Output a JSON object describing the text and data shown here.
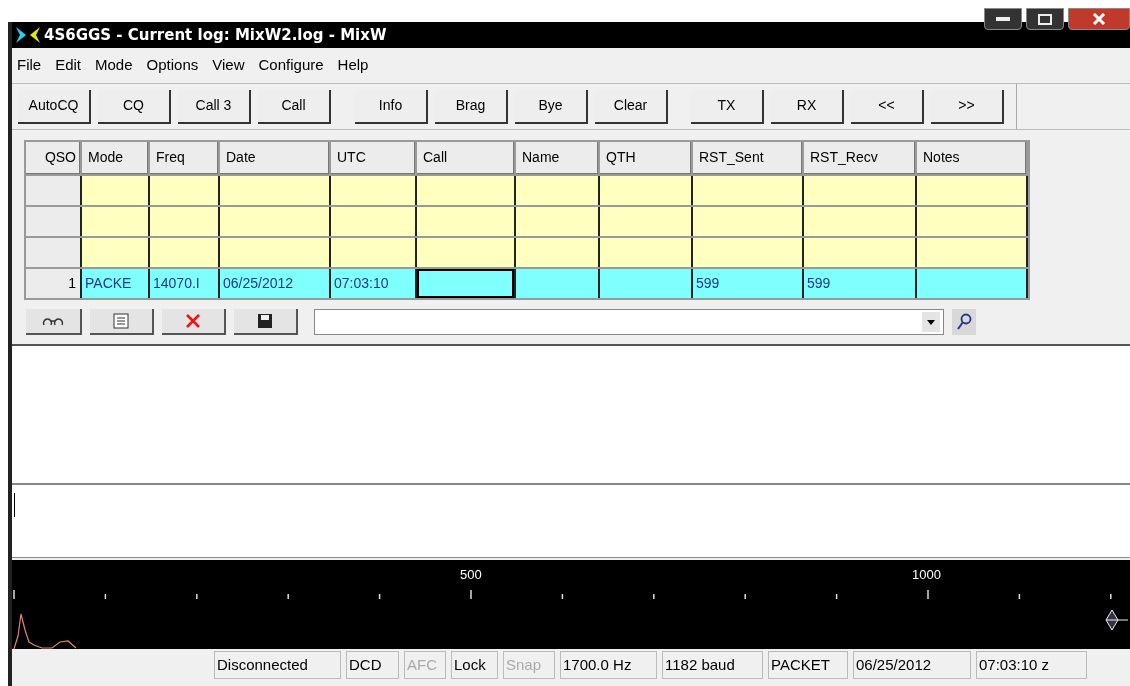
{
  "window": {
    "title": "4S6GGS - Current log: MixW2.log - MixW"
  },
  "menu": [
    "File",
    "Edit",
    "Mode",
    "Options",
    "View",
    "Configure",
    "Help"
  ],
  "macro_buttons": [
    "AutoCQ",
    "CQ",
    "Call 3",
    "Call",
    "Info",
    "Brag",
    "Bye",
    "Clear",
    "TX",
    "RX",
    "<<",
    ">>"
  ],
  "log_table": {
    "columns": [
      "QSO",
      "Mode",
      "Freq",
      "Date",
      "UTC",
      "Call",
      "Name",
      "QTH",
      "RST_Sent",
      "RST_Recv",
      "Notes"
    ],
    "rows": [
      {
        "current": false
      },
      {
        "current": false
      },
      {
        "current": false
      },
      {
        "current": true,
        "qso": "1",
        "cells": [
          {
            "text": "PACKE",
            "focused": false
          },
          {
            "text": "14070.I",
            "focused": false
          },
          {
            "text": "06/25/2012",
            "focused": false
          },
          {
            "text": "07:03:10",
            "focused": false
          },
          {
            "focused": true
          },
          {
            "focused": false
          },
          {
            "focused": false
          },
          {
            "text": "599",
            "focused": false
          },
          {
            "text": "599",
            "focused": false
          },
          {
            "focused": false
          }
        ]
      }
    ]
  },
  "scale": {
    "labels": [
      "500",
      "1000"
    ]
  },
  "status_bar": [
    {
      "text": "Disconnected",
      "disabled": false
    },
    {
      "text": "DCD",
      "disabled": false
    },
    {
      "text": "AFC",
      "disabled": true
    },
    {
      "text": "Lock",
      "disabled": false
    },
    {
      "text": "Snap",
      "disabled": true
    },
    {
      "text": "1700.0 Hz",
      "disabled": false
    },
    {
      "text": "1182 baud",
      "disabled": false
    },
    {
      "text": "PACKET",
      "disabled": false
    },
    {
      "text": "06/25/2012",
      "disabled": false
    },
    {
      "text": "07:03:10 z",
      "disabled": false
    }
  ]
}
